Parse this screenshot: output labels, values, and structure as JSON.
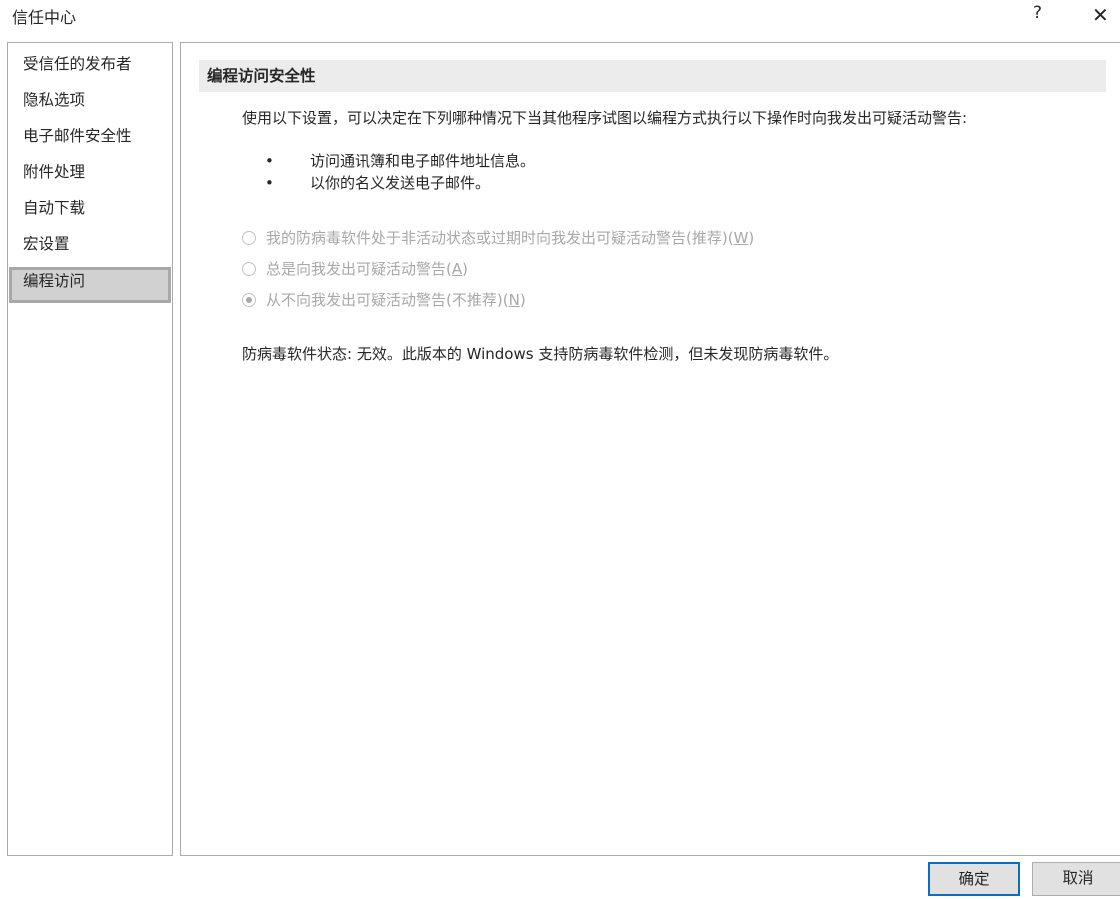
{
  "window": {
    "title": "信任中心",
    "help": "?",
    "close": "✕"
  },
  "sidebar": {
    "items": [
      {
        "label": "受信任的发布者"
      },
      {
        "label": "隐私选项"
      },
      {
        "label": "电子邮件安全性"
      },
      {
        "label": "附件处理"
      },
      {
        "label": "自动下载"
      },
      {
        "label": "宏设置"
      },
      {
        "label": "编程访问",
        "selected": true
      }
    ]
  },
  "main": {
    "header": "编程访问安全性",
    "description": "使用以下设置，可以决定在下列哪种情况下当其他程序试图以编程方式执行以下操作时向我发出可疑活动警告:",
    "bullets": [
      "访问通讯簿和电子邮件地址信息。",
      "以你的名义发送电子邮件。"
    ],
    "bullet_char": "•",
    "options": [
      {
        "label": "我的防病毒软件处于非活动状态或过期时向我发出可疑活动警告(推荐)",
        "key": "W",
        "checked": false
      },
      {
        "label": "总是向我发出可疑活动警告",
        "key": "A",
        "checked": false
      },
      {
        "label": "从不向我发出可疑活动警告(不推荐)",
        "key": "N",
        "checked": true
      }
    ],
    "status": "防病毒软件状态: 无效。此版本的 Windows 支持防病毒软件检测，但未发现防病毒软件。"
  },
  "buttons": {
    "ok": "确定",
    "cancel": "取消"
  },
  "colors": {
    "accent": "#0b6ec3",
    "selected_bg": "#d1d1d1",
    "disabled_text": "#a8a8a8"
  }
}
